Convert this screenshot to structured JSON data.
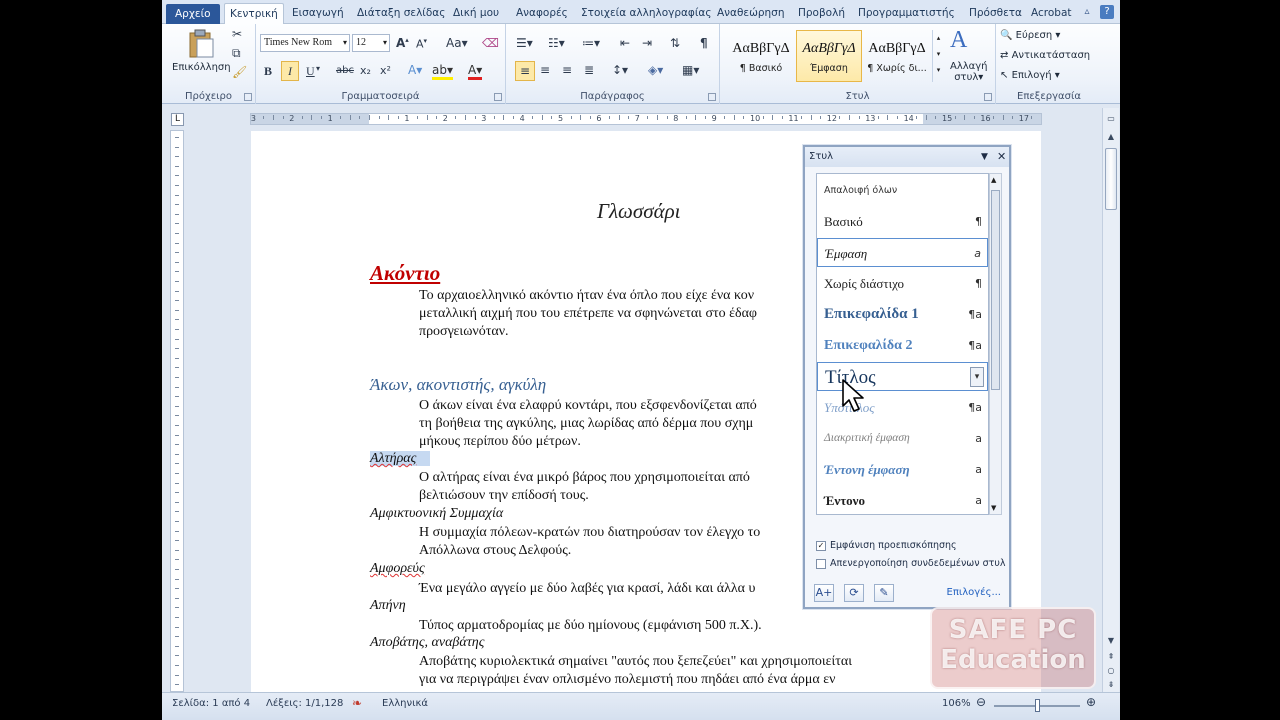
{
  "tabs": [
    "Αρχείο",
    "Κεντρική",
    "Εισαγωγή",
    "Διάταξη σελίδας",
    "Δική μου",
    "Αναφορές",
    "Στοιχεία αλληλογραφίας",
    "Αναθεώρηση",
    "Προβολή",
    "Προγραμματιστής",
    "Πρόσθετα",
    "Acrobat"
  ],
  "ribbon": {
    "clipboard": {
      "paste": "Επικόλληση",
      "label": "Πρόχειρο"
    },
    "font": {
      "name": "Times New Rom",
      "size": "12",
      "label": "Γραμματοσειρά"
    },
    "paragraph": {
      "label": "Παράγραφος"
    },
    "styles": {
      "label": "Στυλ",
      "items": [
        {
          "preview": "ΑαΒβΓγΔ",
          "name": "¶ Βασικό"
        },
        {
          "preview": "ΑαΒβΓγΔ",
          "name": "Έμφαση"
        },
        {
          "preview": "ΑαΒβΓγΔ",
          "name": "¶ Χωρίς δι..."
        }
      ],
      "change_line1": "Αλλαγή",
      "change_line2": "στυλ"
    },
    "editing": {
      "find": "Εύρεση",
      "replace": "Αντικατάσταση",
      "select": "Επιλογή",
      "label": "Επεξεργασία"
    }
  },
  "document": {
    "title": "Γλωσσάρι",
    "h1": "Ακόντιο",
    "p1": [
      "Το αρχαιοελληνικό ακόντιο ήταν ένα όπλο που είχε ένα κον",
      "μεταλλική αιχμή που του επέτρεπε να σφηνώνεται στο έδαφ",
      "προσγειωνόταν."
    ],
    "h2": "Άκων, ακοντιστής, αγκύλη",
    "p2": [
      "Ο άκων είναι ένα ελαφρύ κοντάρι, που εξσφενδονίζεται από",
      "τη βοήθεια της αγκύλης, μιας λωρίδας από δέρμα που σχημ",
      "μήκους περίπου δύο μέτρων."
    ],
    "t3": "Αλτήρας",
    "p3": [
      "Ο αλτήρας είναι ένα μικρό βάρος που χρησιμοποιείται από",
      "βελτιώσουν την επίδοσή τους."
    ],
    "t4": "Αμφικτυονική Συμμαχία",
    "p4": [
      "Η συμμαχία πόλεων-κρατών που διατηρούσαν τον έλεγχο το",
      "Απόλλωνα στους Δελφούς."
    ],
    "t5": "Αμφορεύς",
    "p5": "Ένα μεγάλο αγγείο με δύο λαβές για κρασί, λάδι και άλλα υ",
    "t6": "Απήνη",
    "p6": "Τύπος αρματοδρομίας με δύο ημίονους (εμφάνιση 500 π.Χ.).",
    "t7": "Αποβάτης, αναβάτης",
    "p7": [
      "Αποβάτης κυριολεκτικά σημαίνει \"αυτός που ξεπεζεύει\" και χρησιμοποιείται",
      "για να περιγράψει έναν οπλισμένο πολεμιστή που πηδάει από ένα άρμα εν"
    ]
  },
  "styles_pane": {
    "title": "Στυλ",
    "clear_all": "Απαλοιφή όλων",
    "items": [
      {
        "name": "Βασικό",
        "mark": "¶"
      },
      {
        "name": "Έμφαση",
        "mark": "a"
      },
      {
        "name": "Χωρίς διάστιχο",
        "mark": "¶"
      },
      {
        "name": "Επικεφαλίδα 1",
        "mark": "¶a"
      },
      {
        "name": "Επικεφαλίδα 2",
        "mark": "¶a"
      },
      {
        "name": "Τίτλος",
        "mark": "▾"
      },
      {
        "name": "Υπότιτλος",
        "mark": "¶a"
      },
      {
        "name": "Διακριτική έμφαση",
        "mark": "a"
      },
      {
        "name": "Έντονη έμφαση",
        "mark": "a"
      },
      {
        "name": "Έντονο",
        "mark": "a"
      }
    ],
    "show_preview": "Εμφάνιση προεπισκόπησης",
    "show_preview_checked": true,
    "disable_linked": "Απενεργοποίηση συνδεδεμένων στυλ",
    "disable_linked_checked": false,
    "options": "Επιλογές..."
  },
  "statusbar": {
    "page": "Σελίδα: 1 από 4",
    "words": "Λέξεις: 1/1,128",
    "language": "Ελληνικά",
    "zoom": "106%"
  },
  "watermark": {
    "line1": "SAFE PC",
    "line2": "Education"
  },
  "colors": {
    "file_tab": "#2b579a",
    "heading1": "#c00000",
    "heading2": "#365f91",
    "selection": "#c6d9f1"
  }
}
